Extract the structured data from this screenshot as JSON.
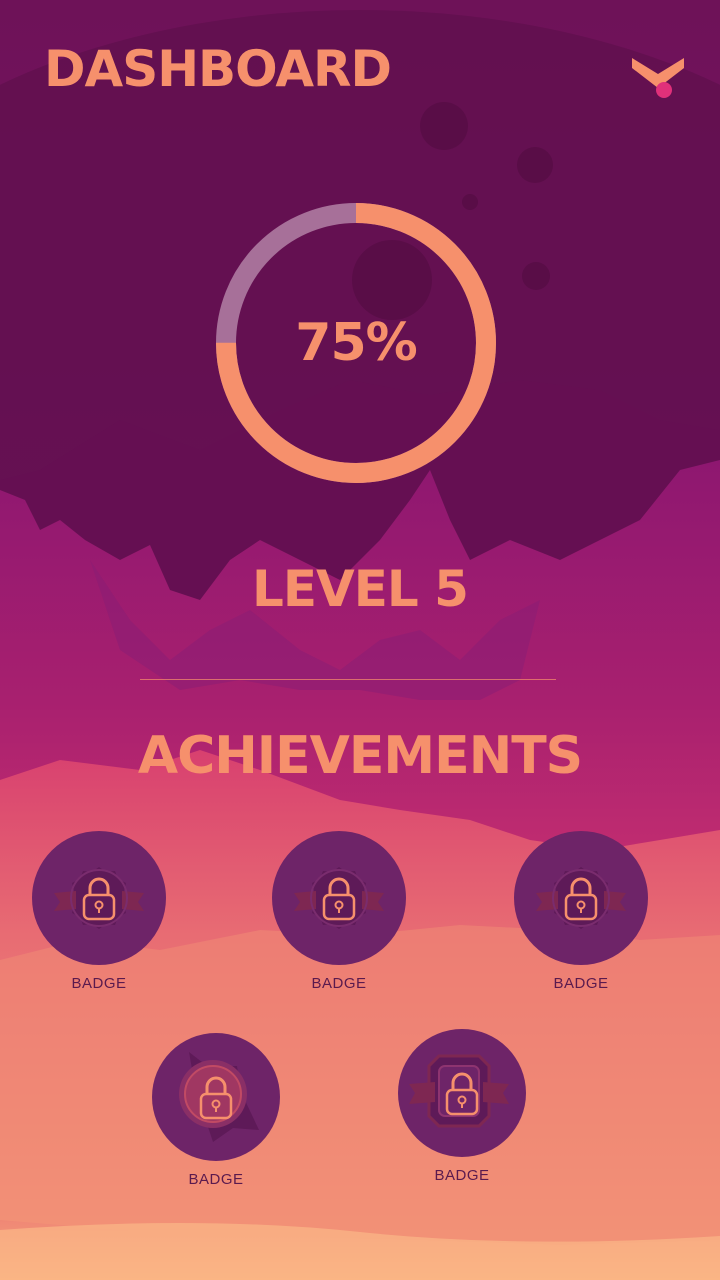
{
  "header": {
    "title": "DASHBOARD",
    "menu_icon": "chevron-down-icon"
  },
  "progress": {
    "value": 0.75,
    "label": "75%"
  },
  "level": {
    "label": "LEVEL 5"
  },
  "achievements": {
    "title": "ACHIEVEMENTS",
    "badges": [
      {
        "label": "BADGE",
        "icon": "lock-icon",
        "emblem": "seal",
        "locked": true
      },
      {
        "label": "BADGE",
        "icon": "lock-icon",
        "emblem": "seal",
        "locked": true
      },
      {
        "label": "BADGE",
        "icon": "lock-icon",
        "emblem": "seal",
        "locked": true
      },
      {
        "label": "BADGE",
        "icon": "lock-icon",
        "emblem": "star",
        "locked": true
      },
      {
        "label": "BADGE",
        "icon": "lock-icon",
        "emblem": "shield",
        "locked": true
      }
    ]
  },
  "colors": {
    "accent": "#F6906C",
    "ring_track": "#A77099",
    "badge_fill": "#6E2468",
    "badge_label": "#5A1A4E",
    "menu_dot": "#E0307A"
  }
}
